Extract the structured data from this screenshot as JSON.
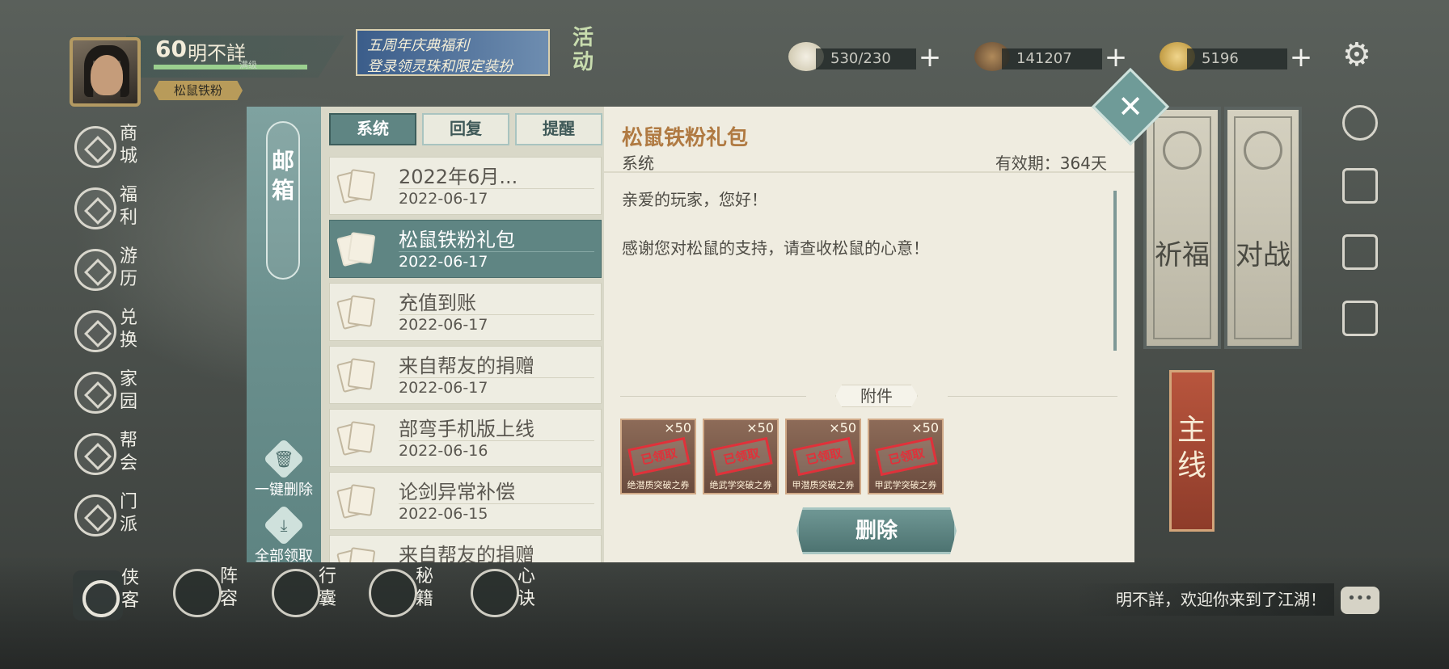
{
  "player": {
    "level": "60",
    "name": "明不詳",
    "exp_label": "满级",
    "title": "松鼠铁粉"
  },
  "banner": {
    "line1": "五周年庆典福利",
    "line2": "登录领灵珠和限定装扮",
    "activity": "活动"
  },
  "currencies": [
    {
      "icon": "bun-icon",
      "value": "530/230"
    },
    {
      "icon": "coins-icon",
      "value": "141207"
    },
    {
      "icon": "ingot-icon",
      "value": "5196"
    }
  ],
  "left_menu": [
    {
      "id": "shop",
      "icon": "shop-icon",
      "label": "商城"
    },
    {
      "id": "welfare",
      "icon": "welfare-icon",
      "label": "福利"
    },
    {
      "id": "travel",
      "icon": "travel-icon",
      "label": "游历"
    },
    {
      "id": "exchange",
      "icon": "exchange-icon",
      "label": "兑换"
    },
    {
      "id": "home",
      "icon": "home-icon",
      "label": "家园"
    },
    {
      "id": "guild",
      "icon": "guild-icon",
      "label": "帮会"
    },
    {
      "id": "sect",
      "icon": "sect-icon",
      "label": "门派"
    }
  ],
  "hero_button": {
    "label": "侠客"
  },
  "bottom_nav": [
    {
      "id": "formation",
      "label": "阵容"
    },
    {
      "id": "bag",
      "label": "行囊"
    },
    {
      "id": "manual",
      "label": "秘籍"
    },
    {
      "id": "heart",
      "label": "心诀"
    }
  ],
  "right_scrolls": {
    "pray": "祈福",
    "battle": "对战",
    "main": "主线"
  },
  "welcome": "明不詳，欢迎你来到了江湖！",
  "mailbox": {
    "title": "邮箱",
    "delete_all": "一键删除",
    "claim_all": "全部领取",
    "tabs": [
      {
        "label": "系统",
        "active": true
      },
      {
        "label": "回复",
        "active": false
      },
      {
        "label": "提醒",
        "active": false
      }
    ],
    "mails": [
      {
        "title": "2022年6月...",
        "date": "2022-06-17",
        "active": false
      },
      {
        "title": "松鼠铁粉礼包",
        "date": "2022-06-17",
        "active": true
      },
      {
        "title": "充值到账",
        "date": "2022-06-17",
        "active": false
      },
      {
        "title": "来自帮友的捐赠",
        "date": "2022-06-17",
        "active": false
      },
      {
        "title": "部弯手机版上线",
        "date": "2022-06-16",
        "active": false
      },
      {
        "title": "论剑异常补偿",
        "date": "2022-06-15",
        "active": false
      },
      {
        "title": "来自帮友的捐赠",
        "date": "",
        "active": false
      }
    ],
    "detail": {
      "title": "松鼠铁粉礼包",
      "sender": "系统",
      "validity": "有效期：364天",
      "greeting": "亲爱的玩家，您好！",
      "body": "感谢您对松鼠的支持，请查收松鼠的心意！",
      "attachment_label": "附件",
      "attachments": [
        {
          "count": "×50",
          "stamp": "已领取",
          "name": "绝潜质突破之券"
        },
        {
          "count": "×50",
          "stamp": "已领取",
          "name": "绝武学突破之券"
        },
        {
          "count": "×50",
          "stamp": "已领取",
          "name": "甲潜质突破之券"
        },
        {
          "count": "×50",
          "stamp": "已领取",
          "name": "甲武学突破之券"
        }
      ],
      "delete_label": "删除"
    }
  }
}
